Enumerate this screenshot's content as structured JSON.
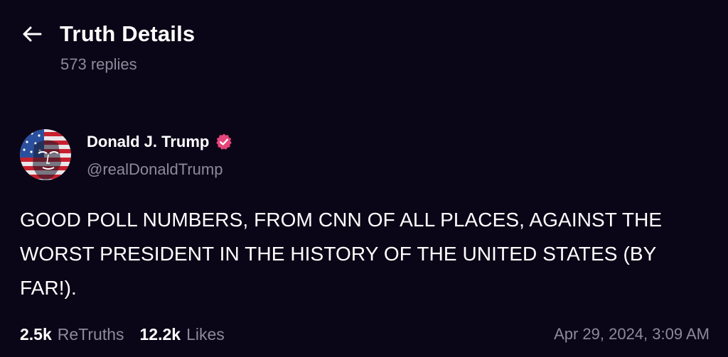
{
  "header": {
    "title": "Truth Details",
    "replies": "573 replies"
  },
  "post": {
    "author_name": "Donald J. Trump",
    "handle": "@realDonaldTrump",
    "text": "GOOD POLL NUMBERS, FROM CNN OF ALL PLACES, AGAINST THE WORST PRESIDENT IN THE HISTORY OF THE UNITED STATES (BY FAR!).",
    "retruths_count": "2.5k",
    "retruths_label": "ReTruths",
    "likes_count": "12.2k",
    "likes_label": "Likes",
    "timestamp": "Apr 29, 2024, 3:09 AM"
  },
  "icons": {
    "back": "arrow-left-icon",
    "verified": "verified-badge-icon"
  },
  "colors": {
    "background": "#0b0617",
    "text": "#ffffff",
    "muted": "#8c8a98",
    "verified": "#e5457a"
  }
}
